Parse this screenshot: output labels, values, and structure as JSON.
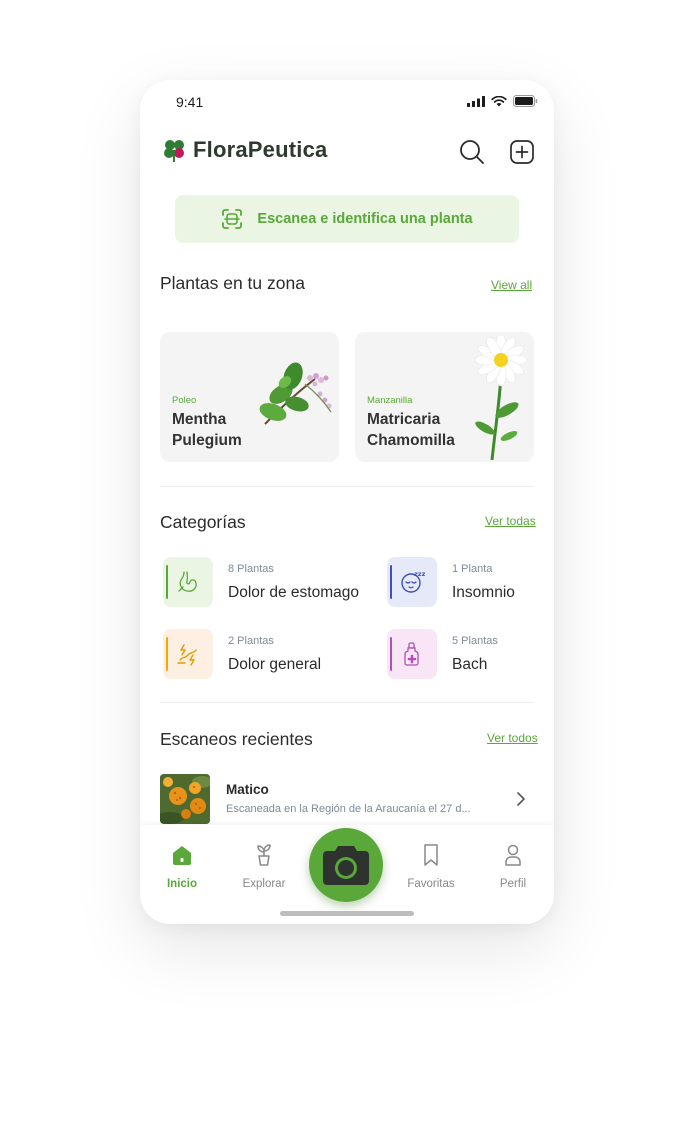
{
  "status_bar": {
    "time": "9:41"
  },
  "header": {
    "app_name": "FloraPeutica"
  },
  "scan_banner": {
    "label": "Escanea e identifica una planta"
  },
  "zone_section": {
    "title": "Plantas en tu zona",
    "link": "View all",
    "plants": [
      {
        "common_name": "Poleo",
        "scientific_line1": "Mentha",
        "scientific_line2": "Pulegium"
      },
      {
        "common_name": "Manzanilla",
        "scientific_line1": "Matricaria",
        "scientific_line2": "Chamomilla"
      }
    ]
  },
  "categories_section": {
    "title": "Categorías",
    "link": "Ver todas",
    "items": [
      {
        "count": "8 Plantas",
        "name": "Dolor de estomago",
        "color": "#5aa73a",
        "bg": "#eaf6e3",
        "icon": "stomach-icon"
      },
      {
        "count": "1 Planta",
        "name": "Insomnio",
        "color": "#3f51b5",
        "bg": "#e6e9f8",
        "icon": "sleep-icon"
      },
      {
        "count": "2 Plantas",
        "name": "Dolor general",
        "color": "#f2a900",
        "bg": "#fdf0e3",
        "icon": "pain-icon"
      },
      {
        "count": "5 Plantas",
        "name": "Bach",
        "color": "#b04fb6",
        "bg": "#f8e5f6",
        "icon": "dropper-bottle-icon"
      }
    ]
  },
  "recent_section": {
    "title": "Escaneos recientes",
    "link": "Ver todos",
    "items": [
      {
        "title": "Matico",
        "description": "Escaneada en la Región de la Araucanía el 27 d..."
      }
    ]
  },
  "tabbar": {
    "tabs": [
      {
        "label": "Inicio",
        "icon": "home-icon",
        "active": true
      },
      {
        "label": "Explorar",
        "icon": "plant-pot-icon",
        "active": false
      },
      {
        "label": "Favoritas",
        "icon": "bookmark-icon",
        "active": false
      },
      {
        "label": "Perfil",
        "icon": "user-icon",
        "active": false
      }
    ]
  },
  "colors": {
    "accent": "#5aa73a",
    "accent_light": "#eaf6e3",
    "text": "#2b2b2b",
    "muted": "#7e8a9a"
  }
}
